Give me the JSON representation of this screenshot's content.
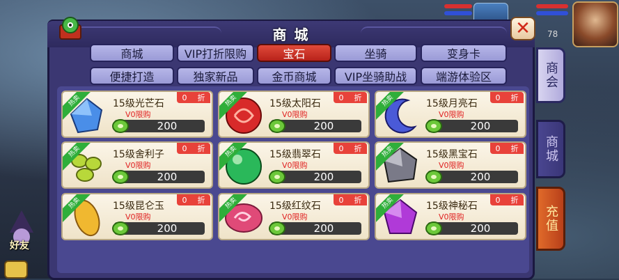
{
  "hud": {
    "level": "78"
  },
  "friend": {
    "label": "好友"
  },
  "panel": {
    "title": "商 城"
  },
  "tabs": [
    {
      "label": "商城",
      "active": false
    },
    {
      "label": "VIP打折限购",
      "active": false
    },
    {
      "label": "宝石",
      "active": true
    },
    {
      "label": "坐骑",
      "active": false
    },
    {
      "label": "变身卡",
      "active": false
    },
    {
      "label": "便捷打造",
      "active": false
    },
    {
      "label": "独家新品",
      "active": false
    },
    {
      "label": "金币商城",
      "active": false
    },
    {
      "label": "VIP坐骑助战",
      "active": false
    },
    {
      "label": "端游体验区",
      "active": false
    }
  ],
  "items": [
    {
      "name": "15级光芒石",
      "vip": "V0限购",
      "discount_value": "0",
      "discount_unit": "折",
      "price": "200",
      "badge": "热卖",
      "gem": "blue-crystal",
      "color": "#4a8ee8"
    },
    {
      "name": "15级太阳石",
      "vip": "V0限购",
      "discount_value": "0",
      "discount_unit": "折",
      "price": "200",
      "badge": "热卖",
      "gem": "red-orb",
      "color": "#d82a2a"
    },
    {
      "name": "15级月亮石",
      "vip": "V0限购",
      "discount_value": "0",
      "discount_unit": "折",
      "price": "200",
      "badge": "热卖",
      "gem": "moon",
      "color": "#4a5ad8"
    },
    {
      "name": "15级舍利子",
      "vip": "V0限购",
      "discount_value": "0",
      "discount_unit": "折",
      "price": "200",
      "badge": "热卖",
      "gem": "green-beads",
      "color": "#b8d83a"
    },
    {
      "name": "15级翡翠石",
      "vip": "V0限购",
      "discount_value": "0",
      "discount_unit": "折",
      "price": "200",
      "badge": "热卖",
      "gem": "green-orb",
      "color": "#2ab85a"
    },
    {
      "name": "15级黑宝石",
      "vip": "V0限购",
      "discount_value": "0",
      "discount_unit": "折",
      "price": "200",
      "badge": "热卖",
      "gem": "black-diamond",
      "color": "#7a7a88"
    },
    {
      "name": "15级昆仑玉",
      "vip": "V0限购",
      "discount_value": "0",
      "discount_unit": "折",
      "price": "200",
      "badge": "热卖",
      "gem": "yellow-jade",
      "color": "#f0b830"
    },
    {
      "name": "15级红纹石",
      "vip": "V0限购",
      "discount_value": "0",
      "discount_unit": "折",
      "price": "200",
      "badge": "热卖",
      "gem": "pink-swirl",
      "color": "#e04a78"
    },
    {
      "name": "15级神秘石",
      "vip": "V0限购",
      "discount_value": "0",
      "discount_unit": "折",
      "price": "200",
      "badge": "热卖",
      "gem": "purple-crystal",
      "color": "#b03ad8"
    }
  ],
  "side_tabs": [
    {
      "label": "商会"
    },
    {
      "label": "商城"
    },
    {
      "label": "充值"
    }
  ]
}
